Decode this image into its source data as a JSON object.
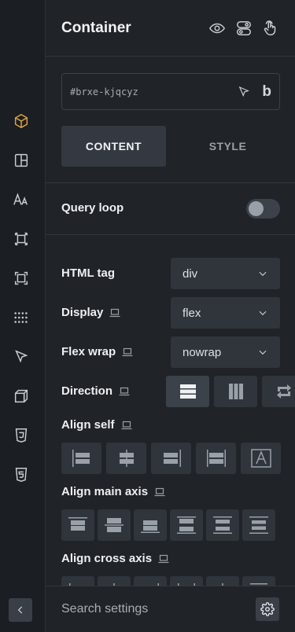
{
  "panel": {
    "title": "Container",
    "element_id": "#brxe-kjqcyz",
    "id_suffix_glyph": "b",
    "tabs": [
      {
        "label": "CONTENT",
        "active": true
      },
      {
        "label": "STYLE",
        "active": false
      }
    ]
  },
  "query_loop": {
    "label": "Query loop",
    "enabled": false
  },
  "settings": {
    "html_tag": {
      "label": "HTML tag",
      "value": "div"
    },
    "display": {
      "label": "Display",
      "value": "flex"
    },
    "flex_wrap": {
      "label": "Flex wrap",
      "value": "nowrap"
    },
    "direction": {
      "label": "Direction"
    },
    "align_self": {
      "label": "Align self"
    },
    "align_main_axis": {
      "label": "Align main axis"
    },
    "align_cross_axis": {
      "label": "Align cross axis"
    }
  },
  "footer": {
    "search_placeholder": "Search settings"
  },
  "colors": {
    "rail_bg": "#1b1e22",
    "panel_bg": "#202328",
    "accent_orange": "#e3a23d",
    "control_bg": "#30353c"
  },
  "rail_icons": [
    "box-icon",
    "layout-icon",
    "typography-icon",
    "spacing-icon",
    "sizing-icon",
    "grid-dots-icon",
    "cursor-icon",
    "3d-cube-icon",
    "css3-icon",
    "html5-icon"
  ]
}
